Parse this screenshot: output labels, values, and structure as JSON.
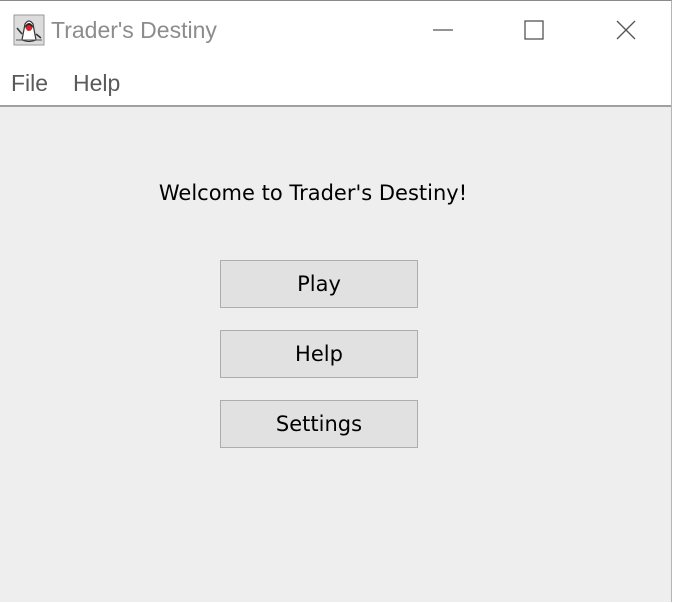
{
  "window": {
    "title": "Trader's Destiny",
    "icon": "java-duke-icon"
  },
  "menu": {
    "items": [
      {
        "label": "File"
      },
      {
        "label": "Help"
      }
    ]
  },
  "main": {
    "welcome": "Welcome to Trader's Destiny!",
    "buttons": [
      {
        "label": "Play"
      },
      {
        "label": "Help"
      },
      {
        "label": "Settings"
      }
    ]
  },
  "colors": {
    "content_bg": "#eeeeee",
    "button_bg": "#e1e1e1",
    "title_text": "#8c8c8c"
  }
}
